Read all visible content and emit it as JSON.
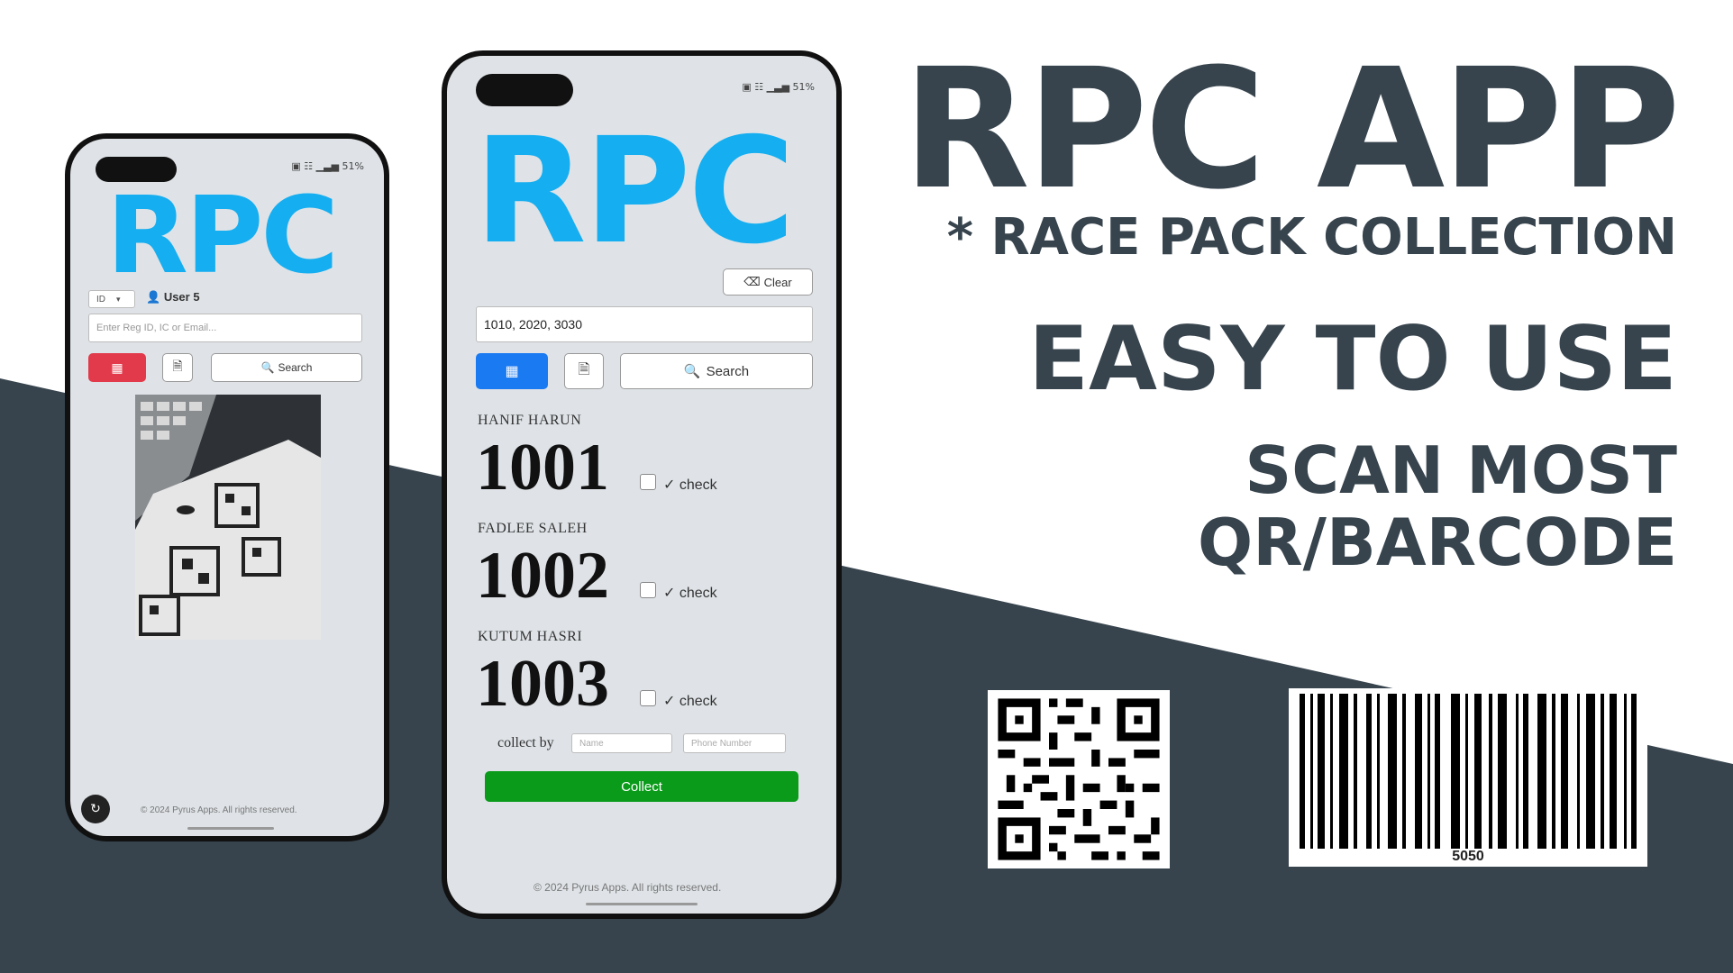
{
  "colors": {
    "accent": "#15aef0",
    "dark": "#37444d",
    "red": "#e23a4a",
    "blue": "#1a7af2",
    "green": "#0a9b1a"
  },
  "hero": {
    "title": "RPC APP",
    "subtitle": "* RACE PACK COLLECTION",
    "tagline": "EASY TO USE",
    "scan_line1": "SCAN MOST",
    "scan_line2": "QR/BARCODE"
  },
  "phone_left": {
    "status": "▣ ☷ ▁▃▅ 51%",
    "logo": "RPC",
    "select_value": "ID",
    "user_label": "User 5",
    "search_placeholder": "Enter Reg ID, IC or Email...",
    "scan_icon": "qr-scan-icon",
    "file_icon": "file-icon",
    "search_label": "Search",
    "footer": "© 2024 Pyrus Apps. All rights reserved."
  },
  "phone_right": {
    "status": "▣ ☷ ▁▃▅ 51%",
    "logo": "RPC",
    "clear_label": "Clear",
    "search_value": "1010, 2020, 3030",
    "search_label": "Search",
    "results": [
      {
        "name": "HANIF HARUN",
        "number": "1001",
        "check_label": "✓ check"
      },
      {
        "name": "FADLEE SALEH",
        "number": "1002",
        "check_label": "✓ check"
      },
      {
        "name": "KUTUM HASRI",
        "number": "1003",
        "check_label": "✓ check"
      }
    ],
    "collect_by_label": "collect by",
    "name_placeholder": "Name",
    "phone_placeholder": "Phone Number",
    "collect_label": "Collect",
    "footer": "© 2024 Pyrus Apps. All rights reserved."
  },
  "barcode_value": "5050"
}
